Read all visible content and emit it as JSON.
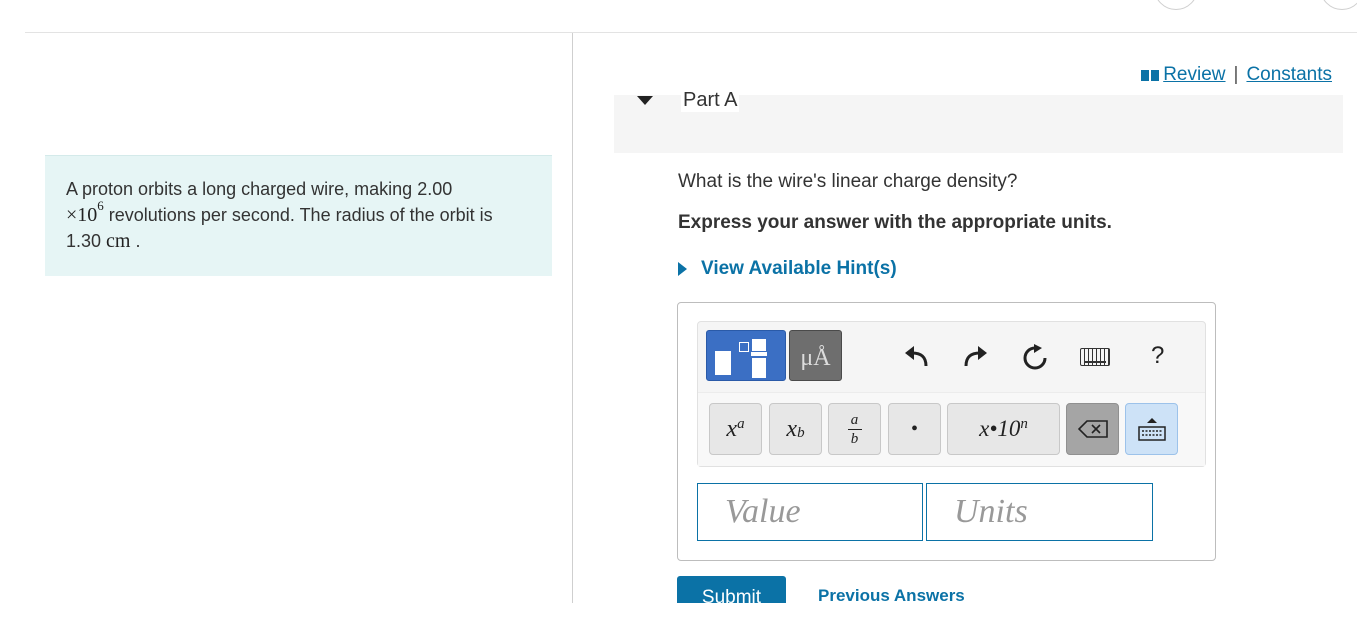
{
  "problem": {
    "text_part1": "A proton orbits a long charged wire, making 2.00",
    "times": "×10",
    "exponent": "6",
    "text_part2": " revolutions per second. The radius of the orbit is 1.30 ",
    "unit": "cm",
    "text_end": " ."
  },
  "links": {
    "review": "Review",
    "separator": "|",
    "constants": "Constants"
  },
  "part": {
    "title": "Part A",
    "question": "What is the wire's linear charge density?",
    "instruction": "Express your answer with the appropriate units.",
    "hints": "View Available Hint(s)"
  },
  "toolbar": {
    "units_button": "μÅ",
    "help": "?",
    "keys": {
      "superscript_base": "x",
      "superscript_exp": "a",
      "subscript_base": "x",
      "subscript_sub": "b",
      "frac_num": "a",
      "frac_den": "b",
      "dot": "•",
      "sci_notation": "x•10",
      "sci_exp": "n"
    }
  },
  "answer": {
    "value_placeholder": "Value",
    "units_placeholder": "Units"
  },
  "actions": {
    "submit": "Submit",
    "previous": "Previous Answers"
  },
  "colors": {
    "accent": "#0b72a6",
    "problem_bg": "#e6f5f5",
    "template_blue": "#3b6fc4"
  }
}
